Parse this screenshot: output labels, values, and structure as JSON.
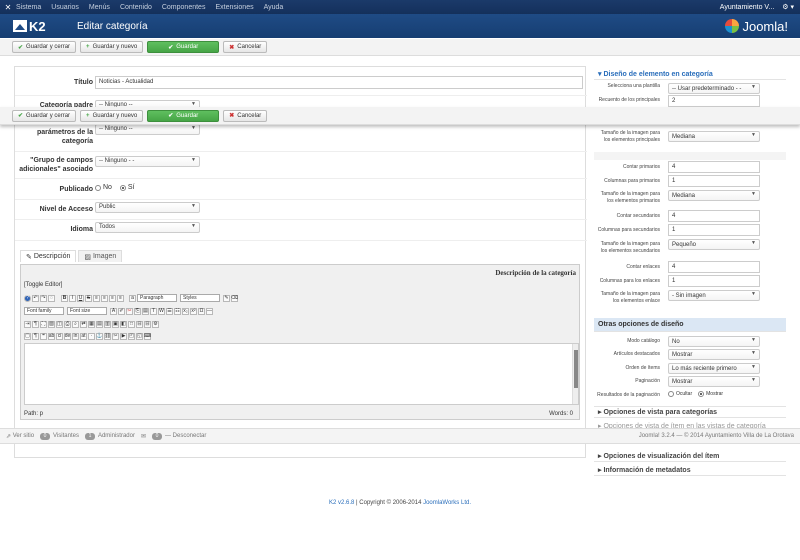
{
  "topnav": {
    "logo_icon": "joomla-x-icon",
    "menu": [
      "Sistema",
      "Usuarios",
      "Menús",
      "Contenido",
      "Componentes",
      "Extensiones",
      "Ayuda"
    ],
    "user": "Ayuntamiento V...",
    "settings": "⚙ ▾"
  },
  "header": {
    "app_logo": "K2",
    "title": "Editar categoría",
    "brand": "Joomla!"
  },
  "toolbar": {
    "save_close": "Guardar y cerrar",
    "save_new": "Guardar y nuevo",
    "save": "Guardar",
    "cancel": "Cancelar"
  },
  "form": {
    "title_label": "Título",
    "title_value": "Noticias - Actualidad",
    "parent_label": "Categoría padre",
    "parent_value": "-- Ninguno --",
    "params_label": "parámetros de la categoría",
    "params_value": "-- Ninguno --",
    "fields_label": "\"Grupo de campos adicionales\" asociado",
    "fields_value": "-- Ninguno - -",
    "published_label": "Publicado",
    "published_no": "No",
    "published_yes": "Sí",
    "access_label": "Nivel de Acceso",
    "access_value": "Public",
    "language_label": "Idioma",
    "language_value": "Todos"
  },
  "tabs": {
    "description": "Descripción",
    "image": "Imagen"
  },
  "editor": {
    "heading": "Descripción de la categoría",
    "toggle": "[Toggle Editor]",
    "paragraph": "Paragraph",
    "styles": "Styles",
    "font_family": "Font family",
    "font_size": "Font size",
    "path": "Path: p",
    "words": "Words: 0"
  },
  "sidebar": {
    "layout_header": "▾ Diseño de elemento en categoría",
    "rows": [
      {
        "label": "Selecciona una plantilla",
        "value": "-- Usar predeterminado - -",
        "type": "select"
      },
      {
        "label": "Recuento de los principales",
        "value": "2",
        "type": "input"
      },
      {
        "label": "Tamaño de la imagen para los elementos principales",
        "value": "Mediana",
        "type": "select"
      },
      {
        "label": "Contar primarios",
        "value": "4",
        "type": "input"
      },
      {
        "label": "Columnas para primarios",
        "value": "1",
        "type": "input"
      },
      {
        "label": "Tamaño de la imagen para los elementos primarios",
        "value": "Mediana",
        "type": "select"
      },
      {
        "label": "Contar secundarios",
        "value": "4",
        "type": "input"
      },
      {
        "label": "Columnas para secundarios",
        "value": "1",
        "type": "input"
      },
      {
        "label": "Tamaño de la imagen para los elementos secundarios",
        "value": "Pequeño",
        "type": "select"
      },
      {
        "label": "Contar enlaces",
        "value": "4",
        "type": "input"
      },
      {
        "label": "Columnas para los enlaces",
        "value": "1",
        "type": "input"
      },
      {
        "label": "Tamaño de la imagen para los elementos enlace",
        "value": "- Sin imagen",
        "type": "select"
      }
    ],
    "other_header": "Otras opciones de diseño",
    "other_rows": [
      {
        "label": "Modo catálogo",
        "value": "No"
      },
      {
        "label": "Artículos destacados",
        "value": "Mostrar"
      },
      {
        "label": "Orden de ítems",
        "value": "Lo más reciente primero"
      },
      {
        "label": "Paginación",
        "value": "Mostrar"
      }
    ],
    "pagination_results_label": "Resultados de la paginación",
    "hide": "Ocultar",
    "show": "Mostrar",
    "collapsed": [
      "▸ Opciones de vista para categorías",
      "▸ Opciones de vista de ítem en las vistas de categoría",
      "▸ Opciones de visualización del ítem",
      "▸ Información de metadatos"
    ]
  },
  "statusbar": {
    "view_site": "Ver sitio",
    "visitors_count": "0",
    "visitors": "Visitantes",
    "admins_count": "1",
    "admins": "Administrador",
    "messages_count": "0",
    "logout": "Desconectar",
    "right": "Joomla! 3.2.4 — © 2014 Ayuntamiento Villa de La Orotava"
  },
  "footer": {
    "product": "K2 v2.6.8",
    "copyright": "| Copyright © 2006-2014",
    "company": "JoomlaWorks Ltd."
  }
}
